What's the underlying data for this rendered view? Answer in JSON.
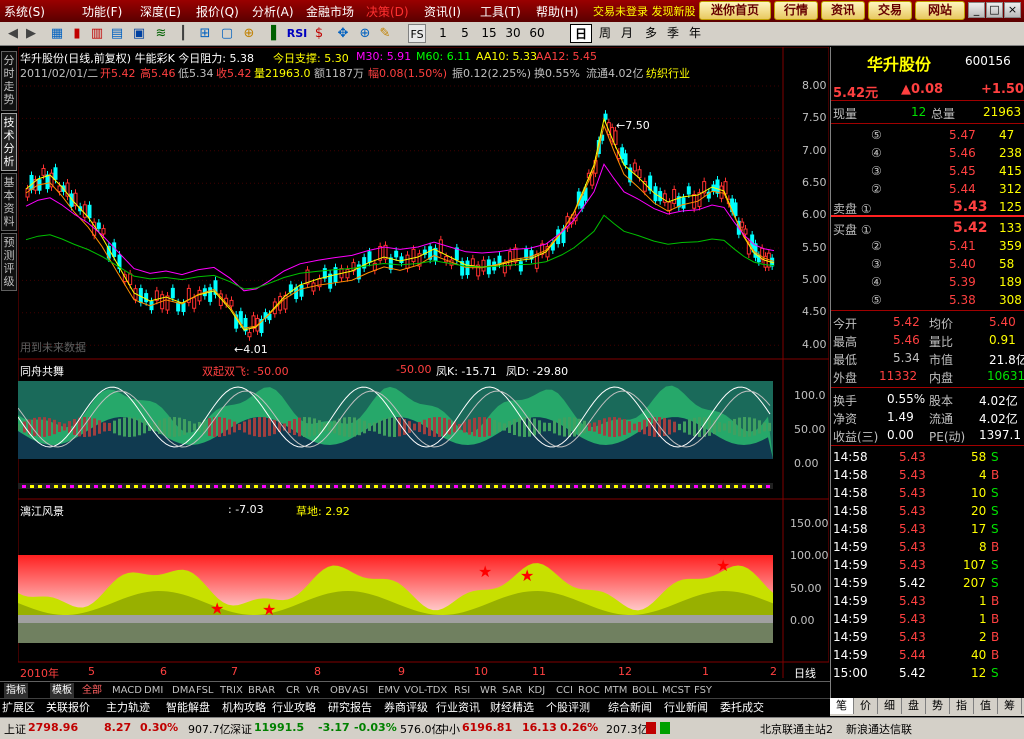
{
  "menu": {
    "items": [
      "系统(S)",
      "功能(F)",
      "深度(E)",
      "报价(Q)",
      "分析(A)",
      "金融市场",
      "决策(D)",
      "资讯(I)",
      "工具(T)",
      "帮助(H)"
    ],
    "promo": "交易未登录 发现新股",
    "nav": [
      "迷你首页",
      "行情",
      "资讯",
      "交易",
      "网站"
    ],
    "win": [
      "_",
      "□",
      "×"
    ]
  },
  "toolbar": {
    "rsi_label": "RSI",
    "fs_label": "FS",
    "periods": [
      "1",
      "5",
      "15",
      "30",
      "60",
      "日",
      "周",
      "月",
      "多",
      "季",
      "年"
    ],
    "selected_period": "日"
  },
  "left_tabs": [
    "分时走势",
    "技术分析",
    "基本资料",
    "预测评级"
  ],
  "main": {
    "title_line": "华升股份(日线,前复权) 牛能彩K 今日阻力: 5.38",
    "support": "今日支撑: 5.30",
    "m30": "M30: 5.91",
    "m60": "M60: 6.11",
    "aa10": "AA10: 5.33",
    "aa12": "AA12: 5.45",
    "info_date": "2011/02/01/二",
    "open": "开5.42",
    "high": "高5.46",
    "low": "低5.34",
    "close": "收5.42",
    "vol": "量21963.0",
    "amount": "额1187万",
    "change": "幅0.08(1.50%)",
    "amp": "振0.12(2.25%)",
    "turnover": "换0.55%",
    "float": "流通4.02亿",
    "industry": "纺织行业",
    "high_mark": "7.50",
    "low_mark": "4.01",
    "watermark": "用到未来数据",
    "yaxis": [
      "8.00",
      "7.50",
      "7.00",
      "6.50",
      "6.00",
      "5.50",
      "5.00",
      "4.50",
      "4.00"
    ]
  },
  "panel2": {
    "name": "同舟共舞",
    "sig": "双起双飞: -50.00",
    "v2": "-50.00",
    "k": "凤K: -15.71",
    "d": "凤D: -29.80",
    "yaxis": [
      "100.0",
      "50.00",
      "0.00"
    ]
  },
  "panel3": {
    "name": "漓江风景",
    "v1": ": -7.03",
    "v2": "草地: 2.92",
    "yaxis": [
      "150.00",
      "100.00",
      "50.00",
      "0.00"
    ]
  },
  "xaxis": {
    "year": "2010年",
    "months": [
      "5",
      "6",
      "7",
      "8",
      "9",
      "10",
      "11",
      "12",
      "1",
      "2"
    ],
    "period": "日线"
  },
  "indicator_tabs": [
    "指标",
    "模板",
    "全部",
    "MACD",
    "DMI",
    "DMA",
    "FSL",
    "TRIX",
    "BRAR",
    "CR",
    "VR",
    "OBV",
    "ASI",
    "EMV",
    "VOL-TDX",
    "RSI",
    "WR",
    "SAR",
    "KDJ",
    "CCI",
    "ROC",
    "MTM",
    "BOLL",
    "MCST",
    "FSY"
  ],
  "func_bar": [
    "扩展区",
    "关联报价",
    "主力轨迹",
    "智能解盘",
    "机构攻略",
    "行业攻略",
    "研究报告",
    "券商评级",
    "行业资讯",
    "财经精选",
    "个股评测",
    "综合新闻",
    "行业新闻",
    "委托成交"
  ],
  "quote": {
    "name": "华升股份",
    "code": "600156",
    "price": "5.42元",
    "arrow_chg": "▲0.08",
    "chg2": "+1.50",
    "xianliang_label": "现量",
    "xianliang": "12",
    "zongliang_label": "总量",
    "zongliang": "21963",
    "asks": [
      {
        "lvl": "⑤",
        "price": "5.47",
        "vol": "47"
      },
      {
        "lvl": "④",
        "price": "5.46",
        "vol": "238"
      },
      {
        "lvl": "③",
        "price": "5.45",
        "vol": "415"
      },
      {
        "lvl": "②",
        "price": "5.44",
        "vol": "312"
      },
      {
        "lvl": "卖盘 ①",
        "price": "5.43",
        "vol": "125"
      }
    ],
    "bids": [
      {
        "lvl": "买盘 ①",
        "price": "5.42",
        "vol": "133"
      },
      {
        "lvl": "②",
        "price": "5.41",
        "vol": "359"
      },
      {
        "lvl": "③",
        "price": "5.40",
        "vol": "58"
      },
      {
        "lvl": "④",
        "price": "5.39",
        "vol": "189"
      },
      {
        "lvl": "⑤",
        "price": "5.38",
        "vol": "308"
      }
    ],
    "stats": [
      {
        "l1": "今开",
        "v1": "5.42",
        "l2": "均价",
        "v2": "5.40"
      },
      {
        "l1": "最高",
        "v1": "5.46",
        "l2": "量比",
        "v2": "0.91"
      },
      {
        "l1": "最低",
        "v1": "5.34",
        "l2": "市值",
        "v2": "21.8亿"
      },
      {
        "l1": "外盘",
        "v1": "11332",
        "l2": "内盘",
        "v2": "10631"
      }
    ],
    "fund": [
      {
        "l1": "换手",
        "v1": "0.55%",
        "l2": "股本",
        "v2": "4.02亿"
      },
      {
        "l1": "净资",
        "v1": "1.49",
        "l2": "流通",
        "v2": "4.02亿"
      },
      {
        "l1": "收益(三)",
        "v1": "0.00",
        "l2": "PE(动)",
        "v2": "1397.1"
      }
    ],
    "ticks": [
      {
        "t": "14:58",
        "p": "5.43",
        "v": "58",
        "s": "S"
      },
      {
        "t": "14:58",
        "p": "5.43",
        "v": "4",
        "s": "B"
      },
      {
        "t": "14:58",
        "p": "5.43",
        "v": "10",
        "s": "S"
      },
      {
        "t": "14:58",
        "p": "5.43",
        "v": "20",
        "s": "S"
      },
      {
        "t": "14:58",
        "p": "5.43",
        "v": "17",
        "s": "S"
      },
      {
        "t": "14:59",
        "p": "5.43",
        "v": "8",
        "s": "B"
      },
      {
        "t": "14:59",
        "p": "5.43",
        "v": "107",
        "s": "S"
      },
      {
        "t": "14:59",
        "p": "5.42",
        "v": "207",
        "s": "S"
      },
      {
        "t": "14:59",
        "p": "5.43",
        "v": "1",
        "s": "B"
      },
      {
        "t": "14:59",
        "p": "5.43",
        "v": "1",
        "s": "B"
      },
      {
        "t": "14:59",
        "p": "5.43",
        "v": "2",
        "s": "B"
      },
      {
        "t": "14:59",
        "p": "5.44",
        "v": "40",
        "s": "B"
      },
      {
        "t": "15:00",
        "p": "5.42",
        "v": "12",
        "s": "S"
      }
    ],
    "bottom_tabs": [
      "笔",
      "价",
      "细",
      "盘",
      "势",
      "指",
      "值",
      "筹"
    ]
  },
  "status": {
    "sh_label": "上证",
    "sh_val": "2798.96",
    "sh_chg": "8.27",
    "sh_pct": "0.30%",
    "sh_amt": "907.7亿",
    "sz_label": "深证",
    "sz_val": "11991.5",
    "sz_chg": "-3.17",
    "sz_pct": "-0.03%",
    "sz_amt": "576.0亿",
    "zx_label": "中小",
    "zx_val": "6196.81",
    "zx_chg": "16.13",
    "zx_pct": "0.26%",
    "zx_amt": "207.3亿",
    "server": "北京联通主站2",
    "news": "新浪通达信联"
  }
}
